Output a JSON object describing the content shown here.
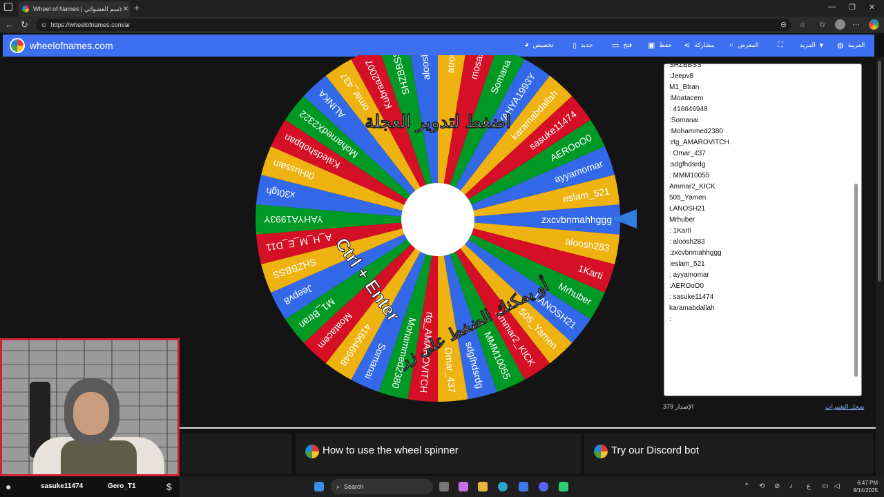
{
  "browser": {
    "tab_title": "Wheel of Names | الاسم العشوائي",
    "url": "https://wheelofnames.com/ar"
  },
  "site": {
    "brand": "wheelofnames.com",
    "nav": [
      {
        "label": "تخصيص",
        "icon": "palette-icon"
      },
      {
        "label": "جديد",
        "icon": "file-icon"
      },
      {
        "label": "فتح",
        "icon": "folder-icon"
      },
      {
        "label": "حفظ",
        "icon": "save-icon"
      },
      {
        "label": "مشاركة",
        "icon": "share-icon"
      },
      {
        "label": "المعرض",
        "icon": "search-icon"
      },
      {
        "label": "",
        "icon": "fullscreen-icon"
      },
      {
        "label": "المزيد",
        "icon": "chevron-down-icon"
      },
      {
        "label": "العربية",
        "icon": "globe-icon"
      }
    ]
  },
  "wheel": {
    "segments": [
      "zxcvbnmahhggg",
      "aloosh283",
      "1Karti",
      "Mrhuber",
      "LANOSH21",
      "505_Yamen",
      "Ammar2_KICK",
      "MMM10055",
      "sdgfhdsrdg",
      "Omar_437",
      "rtg_AMAROVITCH",
      "Mohammed2380",
      "Somanai",
      "416646948",
      "Moatacem",
      "M1_Btran",
      "Jeepv8",
      "SHZBBSS",
      "A_H_M_E_D11",
      "YAHYA1993Y",
      "x30tgh",
      "0tHussain",
      "Kaledshobpan",
      "MohamedX2322",
      "ALINKA",
      "omar_437",
      "Kubraa2007",
      "SHZBBSS",
      "aloosh2",
      "atrosu",
      "mosa5",
      "Somana",
      "YAHYA1993Y",
      "karamabdallah",
      "sasuke11474",
      "AEROoO0",
      "ayyamomar",
      "eslam_521"
    ],
    "colors": [
      "#3369e8",
      "#eeb211",
      "#d50f25",
      "#009925"
    ],
    "overlay_top": "اضغط لتدوير العجلة",
    "overlay_bottom": "أو يمكنك الضغط على زر",
    "overlay_keys": "Ctrl + Enter"
  },
  "entries": [
    "SHZBBSS",
    ":Jeepv8",
    "M1_Btran",
    ":Moatacem",
    ": 416646948",
    ":Somanai",
    ":Mohammed2380",
    ":rtg_AMAROVITCH",
    ": Omar_437",
    ":sdgfhdsrdg",
    ": MMM10055",
    "Ammar2_KICK",
    "505_Yamen",
    "LANOSH21",
    "Mrhuber",
    ": 1Karti",
    ": aloosh283",
    ":zxcvbnmahhggg",
    ":eslam_521",
    ": ayyamomar",
    ":AEROoO0",
    ": sasuke11474",
    "karamabdallah",
    ":"
  ],
  "footer": {
    "version": "الإصدار 379",
    "changelog": "سجل التغييرات"
  },
  "cards": [
    {
      "title": "How to use the wheel spinner"
    },
    {
      "title": "Try our Discord bot"
    }
  ],
  "stream": {
    "user1": "sasuke11474",
    "user2": "Gero_T1"
  },
  "taskbar": {
    "search": "Search",
    "time": "6:47 PM",
    "date": "9/14/2025",
    "lang": "ع"
  }
}
